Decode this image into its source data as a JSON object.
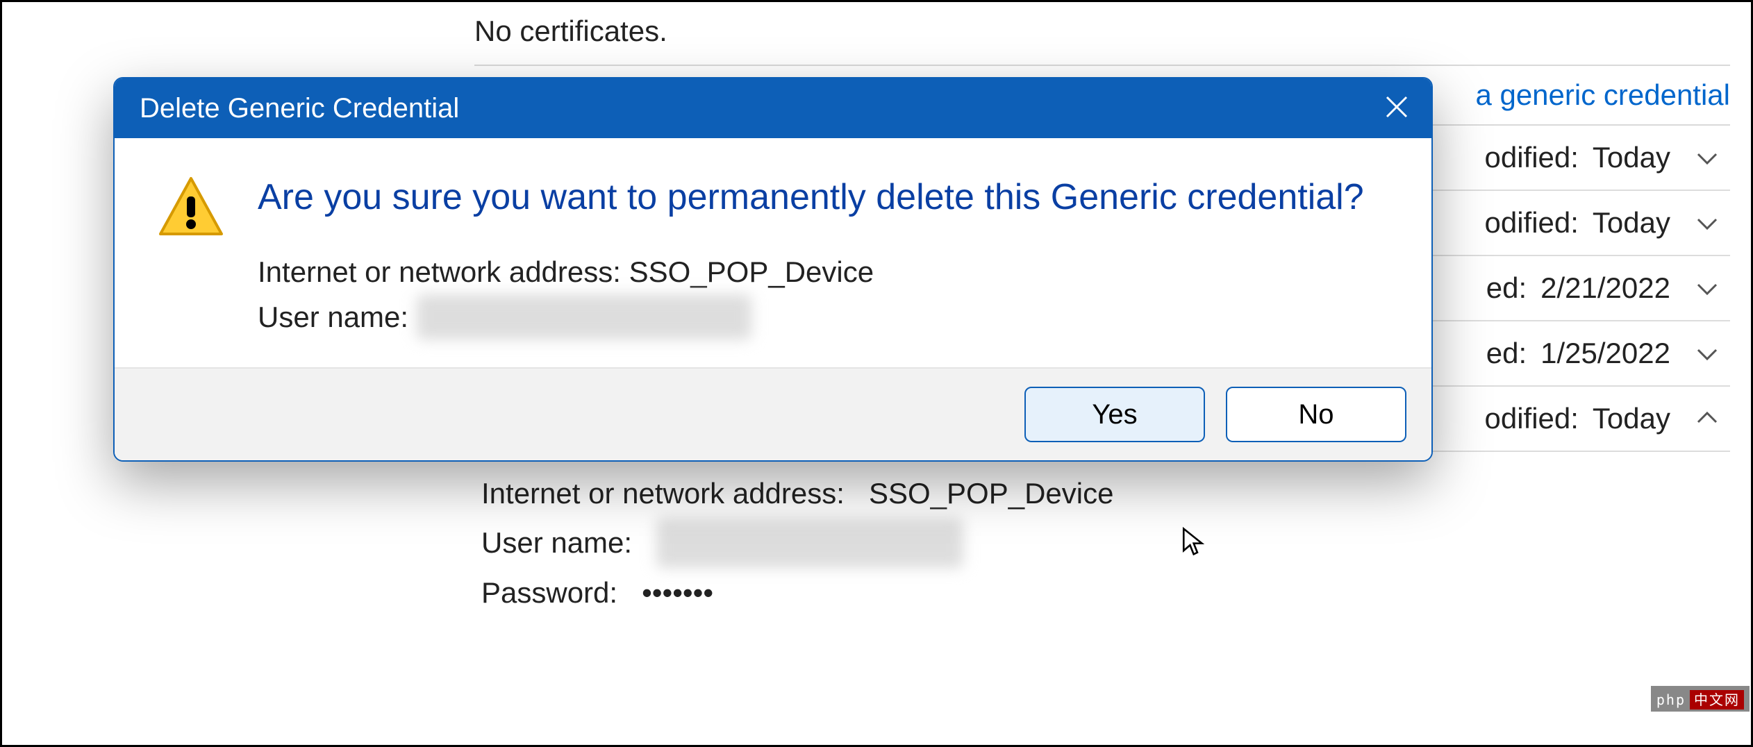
{
  "background": {
    "no_certificates": "No certificates.",
    "add_generic_link": "a generic credential",
    "rows": [
      {
        "modified_label": "odified:",
        "modified_value": "Today",
        "expanded": false
      },
      {
        "modified_label": "odified:",
        "modified_value": "Today",
        "expanded": false
      },
      {
        "modified_label": "ed:",
        "modified_value": "2/21/2022",
        "expanded": false
      },
      {
        "modified_label": "ed:",
        "modified_value": "1/25/2022",
        "expanded": false
      },
      {
        "modified_label": "odified:",
        "modified_value": "Today",
        "expanded": true
      }
    ],
    "detail": {
      "address_label": "Internet or network address:",
      "address_value": "SSO_POP_Device",
      "username_label": "User name:",
      "username_value": "redacted username",
      "password_label": "Password:",
      "password_value": "•••••••"
    }
  },
  "dialog": {
    "title": "Delete Generic Credential",
    "headline": "Are you sure you want to permanently delete this Generic credential?",
    "address_label": "Internet or network address:",
    "address_value": "SSO_POP_Device",
    "username_label": "User name:",
    "username_value": "redacted username",
    "yes": "Yes",
    "no": "No"
  },
  "watermark": {
    "left": "php",
    "right": "中文网"
  }
}
